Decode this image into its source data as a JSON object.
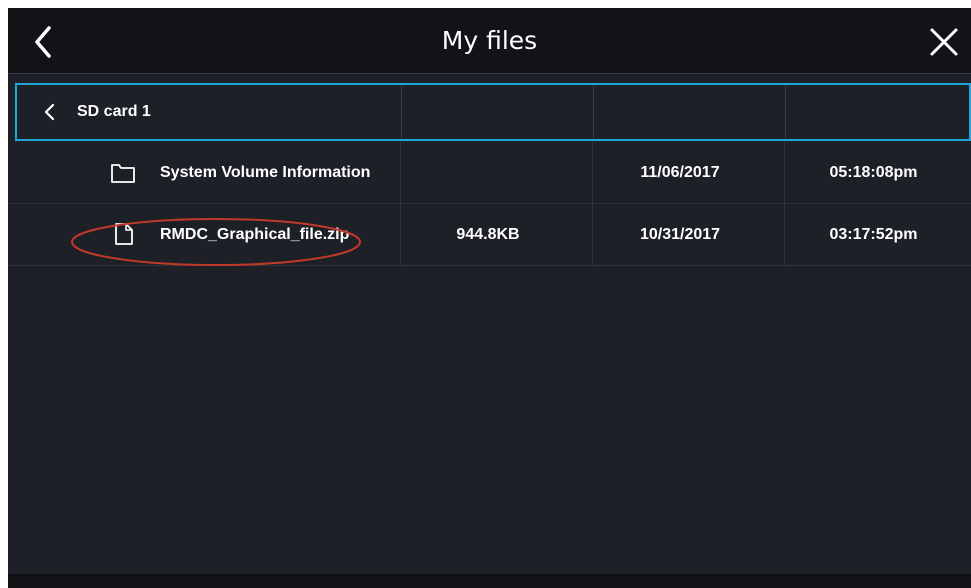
{
  "header": {
    "title": "My files",
    "back_icon": "chevron-left-icon",
    "close_icon": "close-icon"
  },
  "pathbar": {
    "back_icon": "chevron-left-icon",
    "location": "SD card 1"
  },
  "files": [
    {
      "icon": "folder-icon",
      "name": "System Volume Information",
      "size": "",
      "date": "11/06/2017",
      "time": "05:18:08pm"
    },
    {
      "icon": "file-icon",
      "name": "RMDC_Graphical_file.zip",
      "size": "944.8KB",
      "date": "10/31/2017",
      "time": "03:17:52pm"
    }
  ],
  "annotation": {
    "shape": "ellipse",
    "color": "#c0392b",
    "target": "RMDC_Graphical_file.zip"
  },
  "colors": {
    "background": "#1d2027",
    "titlebar": "#111317",
    "accent": "#1fa6d8",
    "text": "#ffffff"
  }
}
